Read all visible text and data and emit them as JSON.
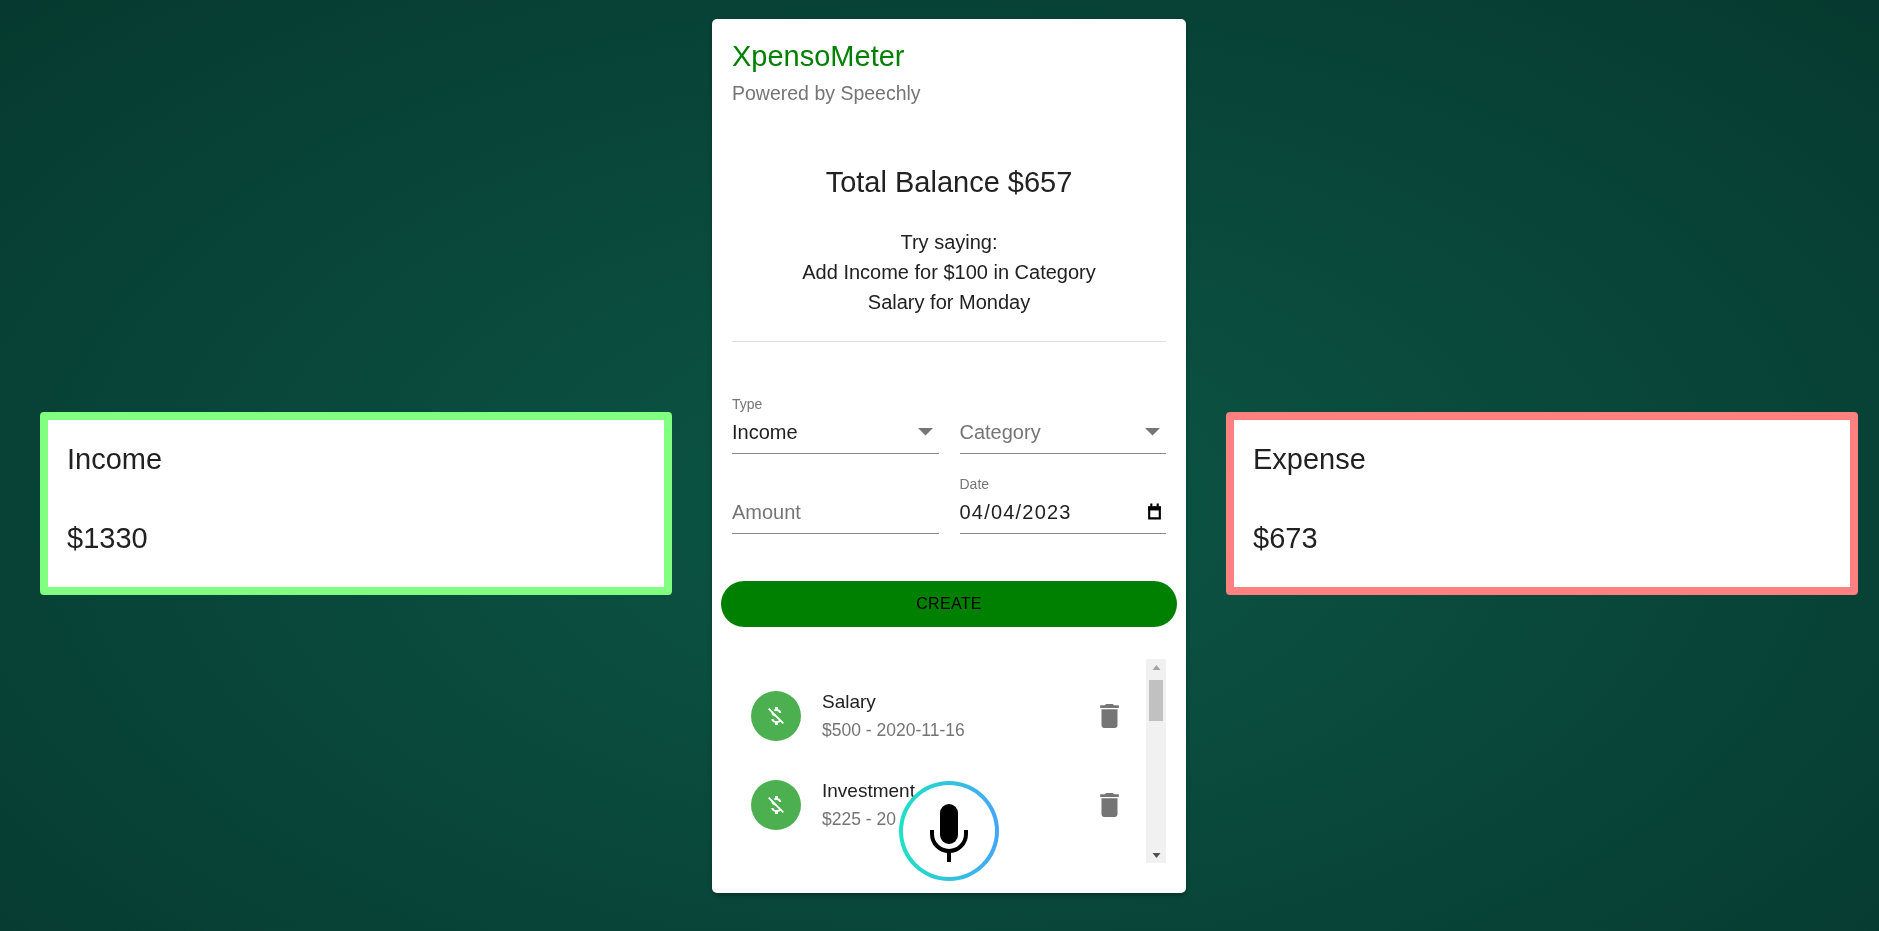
{
  "summary_cards": [
    {
      "title": "Income",
      "amount": "$1330",
      "color": "#80ff80"
    },
    {
      "title": "Expense",
      "amount": "$673",
      "color": "#ff8080"
    }
  ],
  "app": {
    "title": "XpensoMeter",
    "subtitle": "Powered by Speechly",
    "balance": "Total Balance $657",
    "hint_label": "Try saying:",
    "hint_example": "Add Income for $100 in Category Salary for Monday"
  },
  "form": {
    "fields": [
      {
        "kind": "select",
        "label": "Type",
        "value": "Income"
      },
      {
        "kind": "select",
        "placeholder": "Category"
      },
      {
        "kind": "text",
        "placeholder": "Amount"
      },
      {
        "kind": "date",
        "label": "Date",
        "value": "04/04/2023"
      }
    ],
    "submit": "CREATE"
  },
  "transactions": [
    {
      "title": "Salary",
      "detail": "$500 - 2020-11-16"
    },
    {
      "title": "Investment",
      "detail": "$225 - 20"
    }
  ]
}
